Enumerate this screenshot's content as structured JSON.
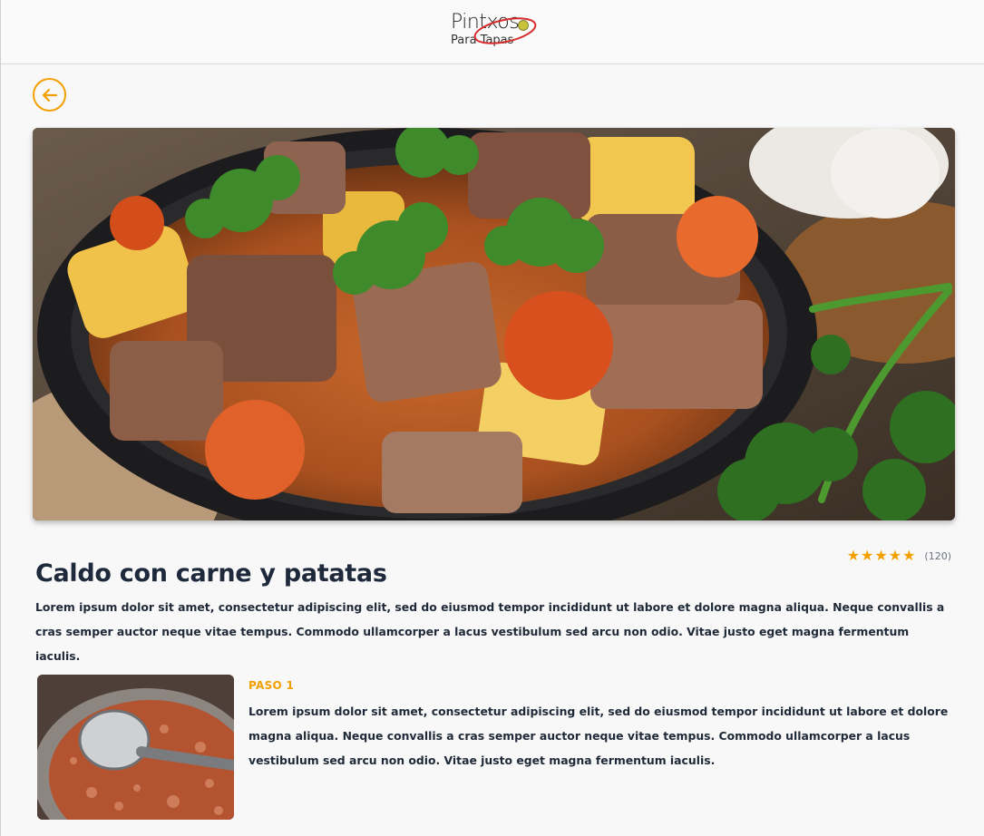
{
  "brand": {
    "logo_top": "Pintxos",
    "logo_bottom": "Para Tapas",
    "accent_color": "#f2a000"
  },
  "nav": {
    "back_icon": "arrow-left-circle-icon"
  },
  "recipe": {
    "title": "Caldo con carne y patatas",
    "rating_stars": 5,
    "rating_count": "(120)",
    "description": "Lorem ipsum dolor sit amet, consectetur adipiscing elit, sed do eiusmod tempor incididunt ut labore et dolore magna aliqua. Neque convallis a cras semper auctor neque vitae tempus. Commodo ullamcorper a lacus vestibulum sed arcu non odio. Vitae justo eget magna fermentum iaculis."
  },
  "steps": [
    {
      "label": "PASO 1",
      "text": "Lorem ipsum dolor sit amet, consectetur adipiscing elit, sed do eiusmod tempor incididunt ut labore et dolore magna aliqua. Neque convallis a cras semper auctor neque vitae tempus. Commodo ullamcorper a lacus vestibulum sed arcu non odio. Vitae justo eget magna fermentum iaculis."
    }
  ]
}
